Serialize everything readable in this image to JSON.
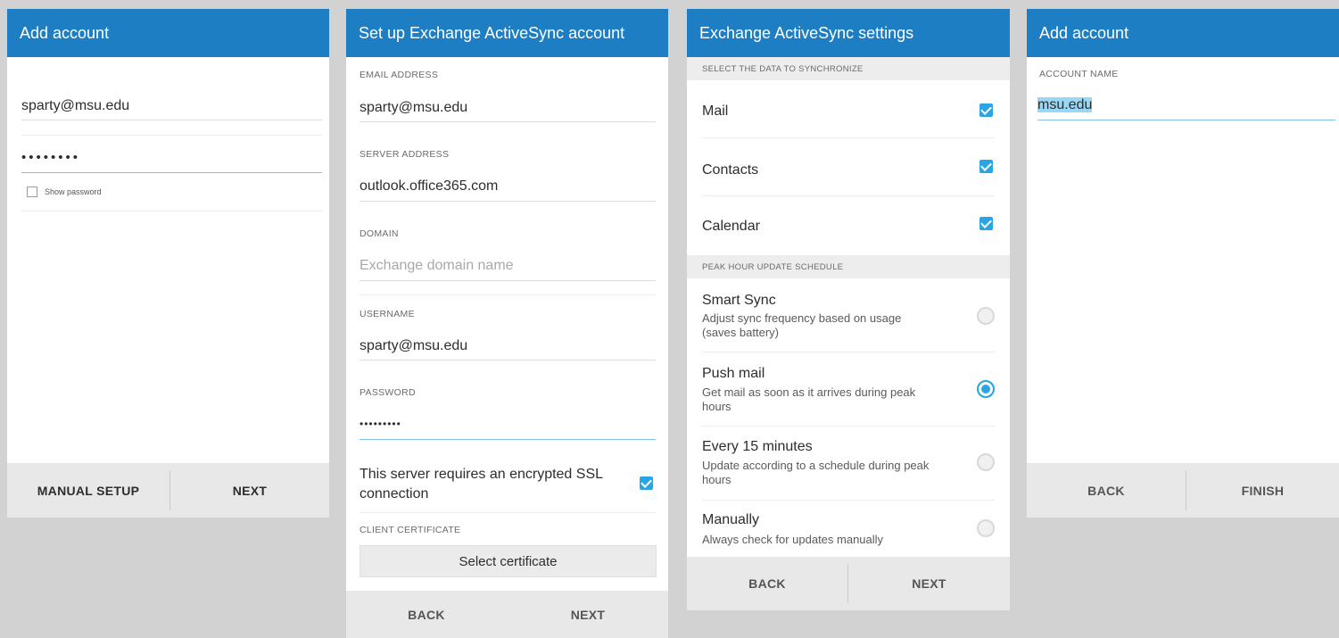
{
  "screens": {
    "add_account": {
      "title": "Add account",
      "email_value": "sparty@msu.edu",
      "password_value": "••••••••",
      "show_password_label": "Show password",
      "manual_setup_label": "MANUAL SETUP",
      "next_label": "NEXT"
    },
    "setup": {
      "title": "Set up Exchange ActiveSync account",
      "email_caption": "EMAIL ADDRESS",
      "email_value": "sparty@msu.edu",
      "server_caption": "SERVER ADDRESS",
      "server_value": "outlook.office365.com",
      "domain_caption": "DOMAIN",
      "domain_placeholder": "Exchange domain name",
      "username_caption": "USERNAME",
      "username_value": "sparty@msu.edu",
      "password_caption": "PASSWORD",
      "password_value": "•••••••••",
      "ssl_label_line1": "This server requires an encrypted SSL",
      "ssl_label_line2": "connection",
      "cert_caption": "CLIENT CERTIFICATE",
      "cert_button": "Select certificate",
      "back_label": "BACK",
      "next_label": "NEXT"
    },
    "settings": {
      "title": "Exchange ActiveSync settings",
      "sync_section": "SELECT THE DATA TO SYNCHRONIZE",
      "sync_items": [
        "Mail",
        "Contacts",
        "Calendar"
      ],
      "peak_section": "PEAK HOUR UPDATE SCHEDULE",
      "schedule": [
        {
          "title": "Smart Sync",
          "sub1": "Adjust sync frequency based on usage",
          "sub2": "(saves battery)",
          "selected": false
        },
        {
          "title": "Push mail",
          "sub1": "Get mail as soon as it arrives during peak",
          "sub2": "hours",
          "selected": true
        },
        {
          "title": "Every 15 minutes",
          "sub1": "Update according to a schedule during peak",
          "sub2": "hours",
          "selected": false
        },
        {
          "title": "Manually",
          "sub1": "Always check for updates manually",
          "sub2": "",
          "selected": false
        }
      ],
      "back_label": "BACK",
      "next_label": "NEXT"
    },
    "name": {
      "title": "Add account",
      "account_caption": "ACCOUNT NAME",
      "account_value": "msu.edu",
      "back_label": "BACK",
      "finish_label": "FINISH"
    }
  },
  "colors": {
    "appbar": "#1e7ec4",
    "accent": "#29a5e3",
    "bottombar": "#e8e8e8"
  }
}
